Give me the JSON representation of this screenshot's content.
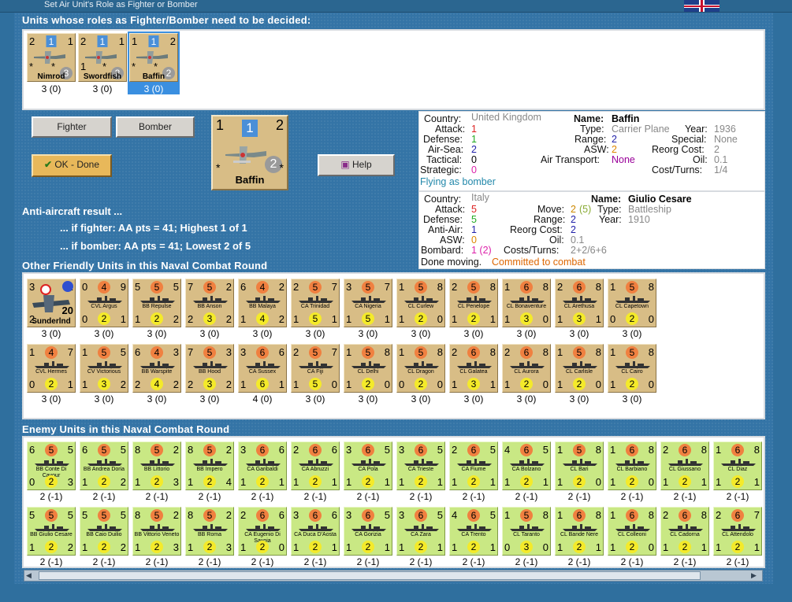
{
  "window": {
    "title": "Set Air Unit's Role as Fighter or Bomber"
  },
  "colors": {
    "frame": "#2f6f9e",
    "panel_bg": "#3474a6",
    "friendly_counter": "#d8bd86",
    "enemy_counter": "#c9e884",
    "attack_circle": "#f08040",
    "defense_circle": "#f4ea2a",
    "select": "#3a8fe0"
  },
  "headers": {
    "undecided": "Units whose roles as Fighter/Bomber need to be decided:",
    "friendly": "Other Friendly Units in this Naval Combat Round",
    "enemy": "Enemy Units in this Naval Combat Round"
  },
  "air_units": [
    {
      "name": "Nimrod",
      "tl": "2",
      "mid": "1",
      "tr": "1",
      "br": "3",
      "tl2": "*",
      "tr2": "*",
      "sub": "3 (0)"
    },
    {
      "name": "Swordfish",
      "tl": "2",
      "mid": "1",
      "tr": "1",
      "br": "2",
      "tl2": "1",
      "tr2": "*",
      "sub": "3 (0)"
    },
    {
      "name": "Baffin",
      "tl": "1",
      "mid": "1",
      "tr": "2",
      "br": "2",
      "tl2": "*",
      "tr2": "*",
      "sub": "3 (0)"
    }
  ],
  "buttons": {
    "fighter": "Fighter",
    "bomber": "Bomber",
    "ok": "OK - Done",
    "help": "Help"
  },
  "big_counter": {
    "name": "Baffin",
    "tl": "1",
    "mid": "1",
    "tr": "2",
    "br": "2",
    "bl": "*",
    "br2": "*"
  },
  "aa": {
    "title": "Anti-aircraft result ...",
    "fighter": "... if fighter:  AA pts = 41; Highest 1 of 1",
    "bomber": "... if bomber:  AA pts = 41; Lowest 2 of 5"
  },
  "air_info": {
    "country_label": "Country:",
    "country": "United Kingdom",
    "name_label": "Name:",
    "name": "Baffin",
    "attack_label": "Attack:",
    "attack": "1",
    "type_label": "Type:",
    "type": "Carrier Plane",
    "year_label": "Year:",
    "year": "1936",
    "defense_label": "Defense:",
    "defense": "1",
    "range_label": "Range:",
    "range": "2",
    "special_label": "Special:",
    "special": "None",
    "airsea_label": "Air-Sea:",
    "airsea": "2",
    "asw_label": "ASW:",
    "asw": "2",
    "reorg_label": "Reorg Cost:",
    "reorg": "2",
    "tactical_label": "Tactical:",
    "tactical": "0",
    "airtransport_label": "Air Transport:",
    "airtransport": "None",
    "oil_label": "Oil:",
    "oil": "0.1",
    "strategic_label": "Strategic:",
    "strategic": "0",
    "cost_label": "Cost/Turns:",
    "cost": "1/4",
    "status": "Flying as bomber"
  },
  "ship_info": {
    "country_label": "Country:",
    "country": "Italy",
    "name_label": "Name:",
    "name": "Giulio Cesare",
    "attack_label": "Attack:",
    "attack": "5",
    "move_label": "Move:",
    "move": "2",
    "move_paren": "(5)",
    "type_label": "Type:",
    "type": "Battleship",
    "defense_label": "Defense:",
    "defense": "5",
    "range_label": "Range:",
    "range": "2",
    "year_label": "Year:",
    "year": "1910",
    "antiair_label": "Anti-Air:",
    "antiair": "1",
    "reorg_label": "Reorg Cost:",
    "reorg": "2",
    "asw_label": "ASW:",
    "asw": "0",
    "oil_label": "Oil:",
    "oil": "0.1",
    "bombard_label": "Bombard:",
    "bombard": "1 (2)",
    "cost_label": "Costs/Turns:",
    "cost": "2+2/6+6",
    "done": "Done moving.",
    "committed": "Committed to combat"
  },
  "friendly_units": [
    {
      "name": "Sunderlnd",
      "tl": "3",
      "mid": "",
      "tr": "2",
      "bl": "2",
      "bot": "",
      "br": "20",
      "sub": "3 (0)",
      "air": true
    },
    {
      "name": "CVL Argus",
      "tl": "0",
      "mid": "4",
      "tr": "9",
      "bl": "0",
      "bot": "2",
      "br": "1",
      "sub": "3 (0)"
    },
    {
      "name": "BB Repulse",
      "tl": "5",
      "mid": "5",
      "tr": "5",
      "bl": "1",
      "bot": "2",
      "br": "2",
      "sub": "3 (0)"
    },
    {
      "name": "BB Anson",
      "tl": "7",
      "mid": "5",
      "tr": "2",
      "bl": "2",
      "bot": "3",
      "br": "2",
      "sub": "3 (0)"
    },
    {
      "name": "BB Malaya",
      "tl": "6",
      "mid": "4",
      "tr": "2",
      "bl": "1",
      "bot": "4",
      "br": "2",
      "sub": "3 (0)"
    },
    {
      "name": "CA Trinidad",
      "tl": "2",
      "mid": "5",
      "tr": "7",
      "bl": "1",
      "bot": "5",
      "br": "1",
      "sub": "3 (0)"
    },
    {
      "name": "CA Nigeria",
      "tl": "3",
      "mid": "5",
      "tr": "7",
      "bl": "1",
      "bot": "5",
      "br": "1",
      "sub": "3 (0)"
    },
    {
      "name": "CL Curlew",
      "tl": "1",
      "mid": "5",
      "tr": "8",
      "bl": "1",
      "bot": "2",
      "br": "0",
      "sub": "3 (0)"
    },
    {
      "name": "CL Penelope",
      "tl": "2",
      "mid": "5",
      "tr": "8",
      "bl": "1",
      "bot": "2",
      "br": "1",
      "sub": "3 (0)"
    },
    {
      "name": "CL Bonaventure",
      "tl": "1",
      "mid": "6",
      "tr": "8",
      "bl": "1",
      "bot": "3",
      "br": "0",
      "sub": "3 (0)"
    },
    {
      "name": "CL Arethusa",
      "tl": "2",
      "mid": "6",
      "tr": "8",
      "bl": "1",
      "bot": "3",
      "br": "1",
      "sub": "3 (0)"
    },
    {
      "name": "CL Capetown",
      "tl": "1",
      "mid": "5",
      "tr": "8",
      "bl": "0",
      "bot": "2",
      "br": "0",
      "sub": "3 (0)"
    },
    {
      "name": "CVL Hermes",
      "tl": "1",
      "mid": "4",
      "tr": "7",
      "bl": "0",
      "bot": "2",
      "br": "1",
      "sub": "3 (0)"
    },
    {
      "name": "CV Victorious",
      "tl": "1",
      "mid": "5",
      "tr": "5",
      "bl": "1",
      "bot": "3",
      "br": "2",
      "sub": "3 (0)"
    },
    {
      "name": "BB Warspite",
      "tl": "6",
      "mid": "4",
      "tr": "3",
      "bl": "2",
      "bot": "4",
      "br": "2",
      "sub": "3 (0)"
    },
    {
      "name": "BB Hood",
      "tl": "7",
      "mid": "5",
      "tr": "3",
      "bl": "2",
      "bot": "3",
      "br": "2",
      "sub": "3 (0)"
    },
    {
      "name": "CA Sussex",
      "tl": "3",
      "mid": "6",
      "tr": "6",
      "bl": "1",
      "bot": "6",
      "br": "1",
      "sub": "4 (0)"
    },
    {
      "name": "CA Fiji",
      "tl": "2",
      "mid": "5",
      "tr": "7",
      "bl": "1",
      "bot": "5",
      "br": "0",
      "sub": "3 (0)"
    },
    {
      "name": "CL Delhi",
      "tl": "1",
      "mid": "5",
      "tr": "8",
      "bl": "1",
      "bot": "2",
      "br": "0",
      "sub": "3 (0)"
    },
    {
      "name": "CL Dragon",
      "tl": "1",
      "mid": "5",
      "tr": "8",
      "bl": "0",
      "bot": "2",
      "br": "0",
      "sub": "3 (0)"
    },
    {
      "name": "CL Galatea",
      "tl": "2",
      "mid": "6",
      "tr": "8",
      "bl": "1",
      "bot": "3",
      "br": "1",
      "sub": "3 (0)"
    },
    {
      "name": "CL Aurora",
      "tl": "2",
      "mid": "6",
      "tr": "8",
      "bl": "1",
      "bot": "2",
      "br": "0",
      "sub": "3 (0)"
    },
    {
      "name": "CL Carlisle",
      "tl": "1",
      "mid": "5",
      "tr": "8",
      "bl": "1",
      "bot": "2",
      "br": "0",
      "sub": "3 (0)"
    },
    {
      "name": "CL Cairo",
      "tl": "1",
      "mid": "5",
      "tr": "8",
      "bl": "1",
      "bot": "2",
      "br": "0",
      "sub": "3 (0)"
    }
  ],
  "enemy_units": [
    {
      "name": "BB Conte Di Cavour",
      "tl": "6",
      "mid": "5",
      "tr": "5",
      "bl": "0",
      "bot": "2",
      "br": "3",
      "sub": "2 (-1)"
    },
    {
      "name": "BB Andrea Doria",
      "tl": "6",
      "mid": "5",
      "tr": "5",
      "bl": "1",
      "bot": "2",
      "br": "2",
      "sub": "2 (-1)"
    },
    {
      "name": "BB Littorio",
      "tl": "8",
      "mid": "5",
      "tr": "2",
      "bl": "1",
      "bot": "2",
      "br": "3",
      "sub": "2 (-1)"
    },
    {
      "name": "BB Impero",
      "tl": "8",
      "mid": "5",
      "tr": "2",
      "bl": "1",
      "bot": "2",
      "br": "4",
      "sub": "2 (-1)"
    },
    {
      "name": "CA Garibaldi",
      "tl": "3",
      "mid": "6",
      "tr": "6",
      "bl": "1",
      "bot": "2",
      "br": "1",
      "sub": "2 (-1)"
    },
    {
      "name": "CA Abruzzi",
      "tl": "2",
      "mid": "6",
      "tr": "6",
      "bl": "1",
      "bot": "2",
      "br": "1",
      "sub": "2 (-1)"
    },
    {
      "name": "CA Pola",
      "tl": "3",
      "mid": "6",
      "tr": "5",
      "bl": "1",
      "bot": "2",
      "br": "1",
      "sub": "2 (-1)"
    },
    {
      "name": "CA Trieste",
      "tl": "3",
      "mid": "6",
      "tr": "5",
      "bl": "1",
      "bot": "2",
      "br": "1",
      "sub": "2 (-1)"
    },
    {
      "name": "CA Fiume",
      "tl": "2",
      "mid": "6",
      "tr": "5",
      "bl": "1",
      "bot": "2",
      "br": "1",
      "sub": "2 (-1)"
    },
    {
      "name": "CA Bolzano",
      "tl": "4",
      "mid": "6",
      "tr": "5",
      "bl": "1",
      "bot": "2",
      "br": "1",
      "sub": "2 (-1)"
    },
    {
      "name": "CL Bari",
      "tl": "1",
      "mid": "5",
      "tr": "8",
      "bl": "1",
      "bot": "2",
      "br": "0",
      "sub": "2 (-1)"
    },
    {
      "name": "CL Barbiano",
      "tl": "1",
      "mid": "6",
      "tr": "8",
      "bl": "1",
      "bot": "2",
      "br": "0",
      "sub": "2 (-1)"
    },
    {
      "name": "CL Giussano",
      "tl": "2",
      "mid": "6",
      "tr": "8",
      "bl": "1",
      "bot": "2",
      "br": "1",
      "sub": "2 (-1)"
    },
    {
      "name": "CL Diaz",
      "tl": "1",
      "mid": "6",
      "tr": "8",
      "bl": "1",
      "bot": "2",
      "br": "1",
      "sub": "2 (-1)"
    },
    {
      "name": "BB Giulio Cesare",
      "tl": "5",
      "mid": "5",
      "tr": "5",
      "bl": "1",
      "bot": "2",
      "br": "2",
      "sub": "2 (-1)"
    },
    {
      "name": "BB Caio Duilio",
      "tl": "5",
      "mid": "5",
      "tr": "5",
      "bl": "1",
      "bot": "2",
      "br": "2",
      "sub": "2 (-1)"
    },
    {
      "name": "BB Vittorio Veneto",
      "tl": "8",
      "mid": "5",
      "tr": "2",
      "bl": "1",
      "bot": "2",
      "br": "3",
      "sub": "2 (-1)"
    },
    {
      "name": "BB Roma",
      "tl": "8",
      "mid": "5",
      "tr": "2",
      "bl": "1",
      "bot": "2",
      "br": "3",
      "sub": "2 (-1)"
    },
    {
      "name": "CA Eugenio Di Savoia",
      "tl": "2",
      "mid": "6",
      "tr": "6",
      "bl": "1",
      "bot": "2",
      "br": "0",
      "sub": "2 (-1)"
    },
    {
      "name": "CA Duca D'Aosta",
      "tl": "3",
      "mid": "6",
      "tr": "6",
      "bl": "1",
      "bot": "2",
      "br": "1",
      "sub": "2 (-1)"
    },
    {
      "name": "CA Gorizia",
      "tl": "3",
      "mid": "6",
      "tr": "5",
      "bl": "1",
      "bot": "2",
      "br": "1",
      "sub": "2 (-1)"
    },
    {
      "name": "CA Zara",
      "tl": "3",
      "mid": "6",
      "tr": "5",
      "bl": "1",
      "bot": "2",
      "br": "1",
      "sub": "2 (-1)"
    },
    {
      "name": "CA Trento",
      "tl": "4",
      "mid": "6",
      "tr": "5",
      "bl": "1",
      "bot": "2",
      "br": "1",
      "sub": "2 (-1)"
    },
    {
      "name": "CL Taranto",
      "tl": "1",
      "mid": "5",
      "tr": "8",
      "bl": "0",
      "bot": "3",
      "br": "0",
      "sub": "2 (-1)"
    },
    {
      "name": "CL Bande Nere",
      "tl": "1",
      "mid": "6",
      "tr": "8",
      "bl": "1",
      "bot": "2",
      "br": "1",
      "sub": "2 (-1)"
    },
    {
      "name": "CL Colleoni",
      "tl": "1",
      "mid": "6",
      "tr": "8",
      "bl": "1",
      "bot": "2",
      "br": "0",
      "sub": "2 (-1)"
    },
    {
      "name": "CL Cadorna",
      "tl": "2",
      "mid": "6",
      "tr": "8",
      "bl": "1",
      "bot": "2",
      "br": "1",
      "sub": "2 (-1)"
    },
    {
      "name": "CL Attendolo",
      "tl": "2",
      "mid": "6",
      "tr": "7",
      "bl": "1",
      "bot": "2",
      "br": "1",
      "sub": "2 (-1)"
    }
  ]
}
